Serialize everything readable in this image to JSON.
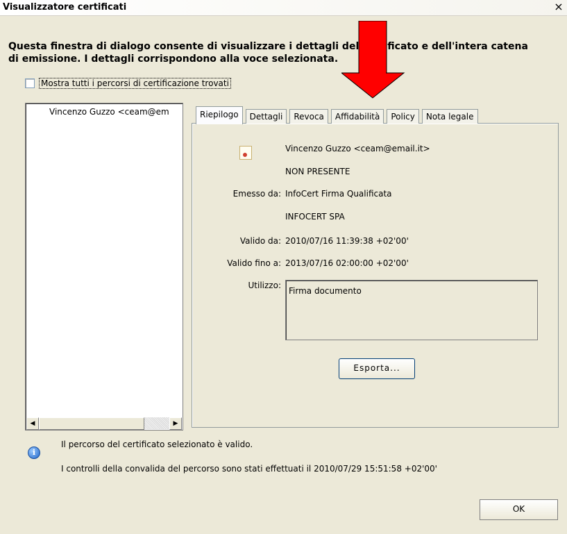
{
  "window": {
    "title": "Visualizzatore certificati",
    "close_glyph": "×"
  },
  "intro": {
    "line1": "Questa finestra di dialogo consente di visualizzare i dettagli del certificato e dell'intera catena",
    "line2": "di emissione. I dettagli corrispondono alla voce selezionata."
  },
  "show_all_paths": {
    "label": "Mostra tutti i percorsi di certificazione trovati",
    "checked": false
  },
  "tree": {
    "items": [
      "Vincenzo Guzzo <ceam@em"
    ]
  },
  "tabs": [
    "Riepilogo",
    "Dettagli",
    "Revoca",
    "Affidabilità",
    "Policy",
    "Nota legale"
  ],
  "summary": {
    "subject_name": "Vincenzo Guzzo <ceam@email.it>",
    "subject_org": "NON PRESENTE",
    "issued_by_label": "Emesso da:",
    "issuer_name": "InfoCert Firma Qualificata",
    "issuer_org": "INFOCERT SPA",
    "valid_from_label": "Valido da:",
    "valid_from": "2010/07/16 11:39:38 +02'00'",
    "valid_to_label": "Valido fino a:",
    "valid_to": "2013/07/16 02:00:00 +02'00'",
    "usage_label": "Utilizzo:",
    "usage": "Firma documento",
    "export_label": "Esporta..."
  },
  "status": {
    "line1": "Il percorso del certificato selezionato è valido.",
    "line2": "I controlli della convalida del percorso sono stati effettuati il 2010/07/29 15:51:58 +02'00'"
  },
  "ok_label": "OK",
  "colors": {
    "arrow": "#ff0000",
    "dialog_bg": "#ece9d8"
  },
  "icons": [
    "close-icon",
    "certificate-icon",
    "info-icon",
    "scroll-left-icon",
    "scroll-right-icon",
    "red-arrow-annotation"
  ]
}
